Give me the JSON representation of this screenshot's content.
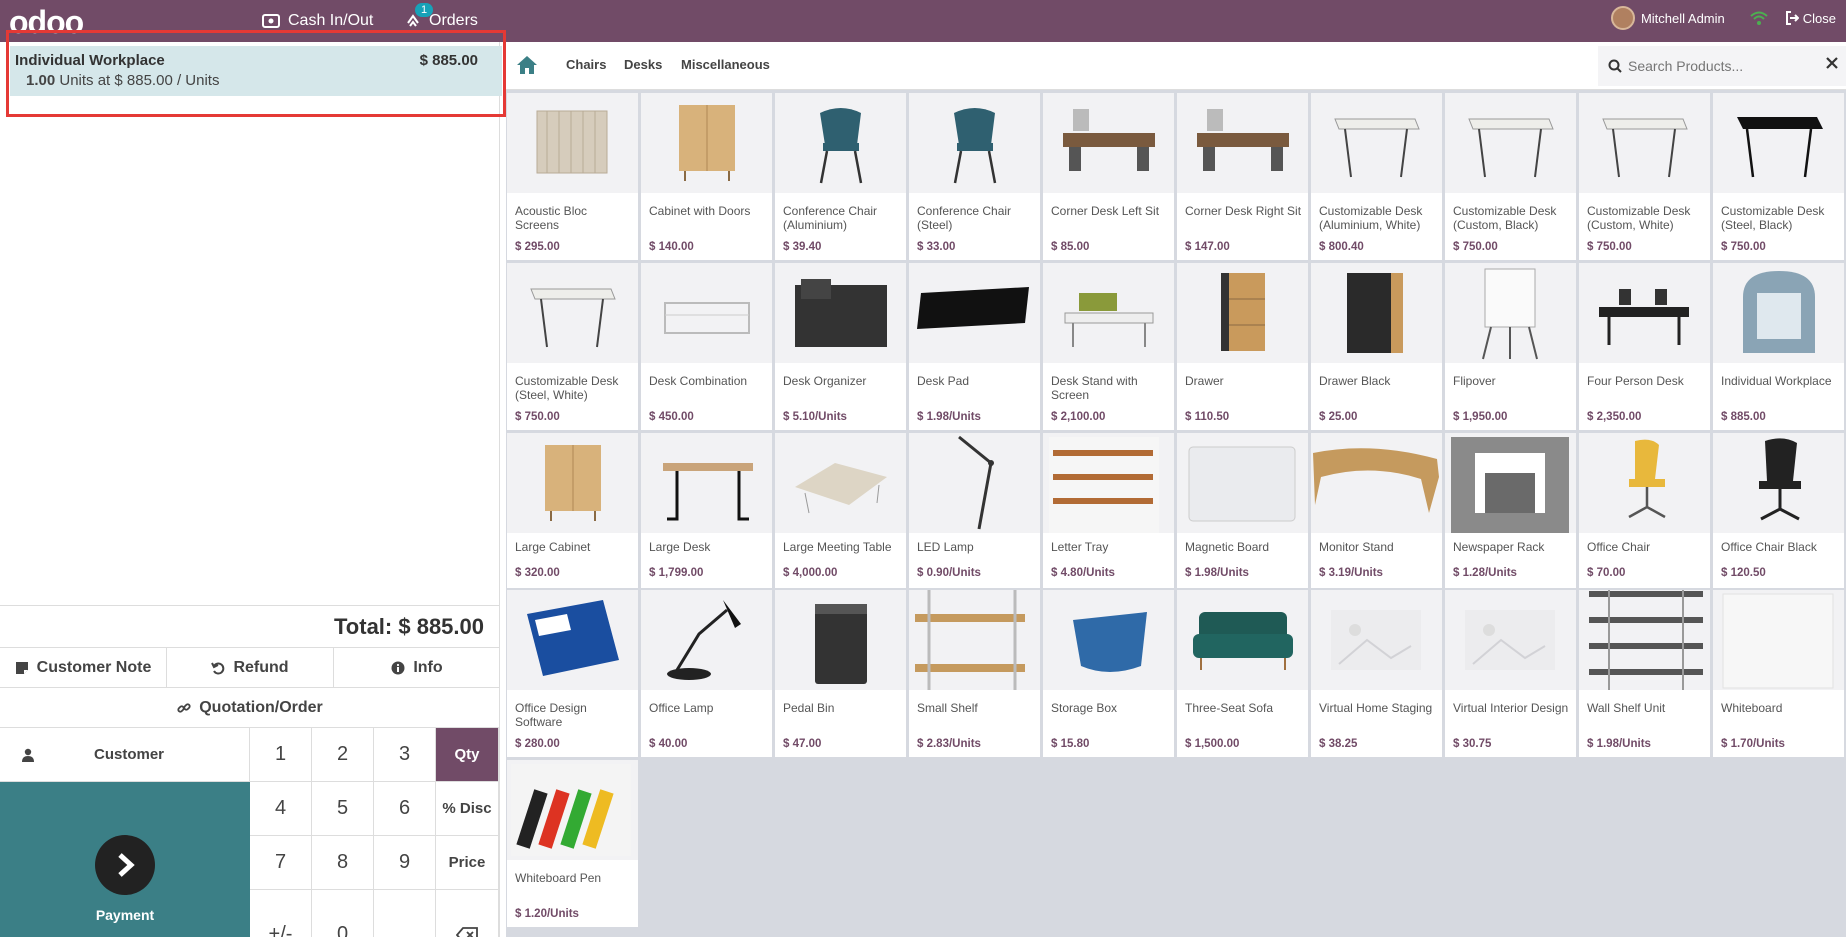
{
  "topbar": {
    "logo": "odoo",
    "cash_label": "Cash In/Out",
    "orders_label": "Orders",
    "orders_badge": "1",
    "user_name": "Mitchell Admin",
    "close_label": "Close"
  },
  "order": {
    "line_name": "Individual Workplace",
    "line_price": "$ 885.00",
    "line_qty": "1.00",
    "line_unit_text": "Units at $ 885.00 / Units",
    "total": "Total: $ 885.00"
  },
  "controls": {
    "customer_note": "Customer Note",
    "refund": "Refund",
    "info": "Info",
    "quotation": "Quotation/Order"
  },
  "numpad": {
    "customer": "Customer",
    "payment": "Payment",
    "keys": [
      "1",
      "2",
      "3",
      "4",
      "5",
      "6",
      "7",
      "8",
      "9",
      "+/-",
      "0",
      "."
    ],
    "qty": "Qty",
    "disc": "% Disc",
    "price": "Price"
  },
  "categories": [
    "Chairs",
    "Desks",
    "Miscellaneous"
  ],
  "search": {
    "placeholder": "Search Products..."
  },
  "products": [
    {
      "name": "Acoustic Bloc Screens",
      "price": "$ 295.00"
    },
    {
      "name": "Cabinet with Doors",
      "price": "$ 140.00"
    },
    {
      "name": "Conference Chair (Aluminium)",
      "price": "$ 39.40"
    },
    {
      "name": "Conference Chair (Steel)",
      "price": "$ 33.00"
    },
    {
      "name": "Corner Desk Left Sit",
      "price": "$ 85.00"
    },
    {
      "name": "Corner Desk Right Sit",
      "price": "$ 147.00"
    },
    {
      "name": "Customizable Desk (Aluminium, White)",
      "price": "$ 800.40"
    },
    {
      "name": "Customizable Desk (Custom, Black)",
      "price": "$ 750.00"
    },
    {
      "name": "Customizable Desk (Custom, White)",
      "price": "$ 750.00"
    },
    {
      "name": "Customizable Desk (Steel, Black)",
      "price": "$ 750.00"
    },
    {
      "name": "Customizable Desk (Steel, White)",
      "price": "$ 750.00"
    },
    {
      "name": "Desk Combination",
      "price": "$ 450.00"
    },
    {
      "name": "Desk Organizer",
      "price": "$ 5.10/Units"
    },
    {
      "name": "Desk Pad",
      "price": "$ 1.98/Units"
    },
    {
      "name": "Desk Stand with Screen",
      "price": "$ 2,100.00"
    },
    {
      "name": "Drawer",
      "price": "$ 110.50"
    },
    {
      "name": "Drawer Black",
      "price": "$ 25.00"
    },
    {
      "name": "Flipover",
      "price": "$ 1,950.00"
    },
    {
      "name": "Four Person Desk",
      "price": "$ 2,350.00"
    },
    {
      "name": "Individual Workplace",
      "price": "$ 885.00"
    },
    {
      "name": "Large Cabinet",
      "price": "$ 320.00"
    },
    {
      "name": "Large Desk",
      "price": "$ 1,799.00"
    },
    {
      "name": "Large Meeting Table",
      "price": "$ 4,000.00"
    },
    {
      "name": "LED Lamp",
      "price": "$ 0.90/Units"
    },
    {
      "name": "Letter Tray",
      "price": "$ 4.80/Units"
    },
    {
      "name": "Magnetic Board",
      "price": "$ 1.98/Units"
    },
    {
      "name": "Monitor Stand",
      "price": "$ 3.19/Units"
    },
    {
      "name": "Newspaper Rack",
      "price": "$ 1.28/Units"
    },
    {
      "name": "Office Chair",
      "price": "$ 70.00"
    },
    {
      "name": "Office Chair Black",
      "price": "$ 120.50"
    },
    {
      "name": "Office Design Software",
      "price": "$ 280.00"
    },
    {
      "name": "Office Lamp",
      "price": "$ 40.00"
    },
    {
      "name": "Pedal Bin",
      "price": "$ 47.00"
    },
    {
      "name": "Small Shelf",
      "price": "$ 2.83/Units"
    },
    {
      "name": "Storage Box",
      "price": "$ 15.80"
    },
    {
      "name": "Three-Seat Sofa",
      "price": "$ 1,500.00"
    },
    {
      "name": "Virtual Home Staging",
      "price": "$ 38.25"
    },
    {
      "name": "Virtual Interior Design",
      "price": "$ 30.75"
    },
    {
      "name": "Wall Shelf Unit",
      "price": "$ 1.98/Units"
    },
    {
      "name": "Whiteboard",
      "price": "$ 1.70/Units"
    },
    {
      "name": "Whiteboard Pen",
      "price": "$ 1.20/Units"
    }
  ],
  "colors": {
    "brand": "#714b67",
    "teal": "#3b7f86",
    "selected_line": "#d5e7ea",
    "highlight_border": "#e53935"
  }
}
